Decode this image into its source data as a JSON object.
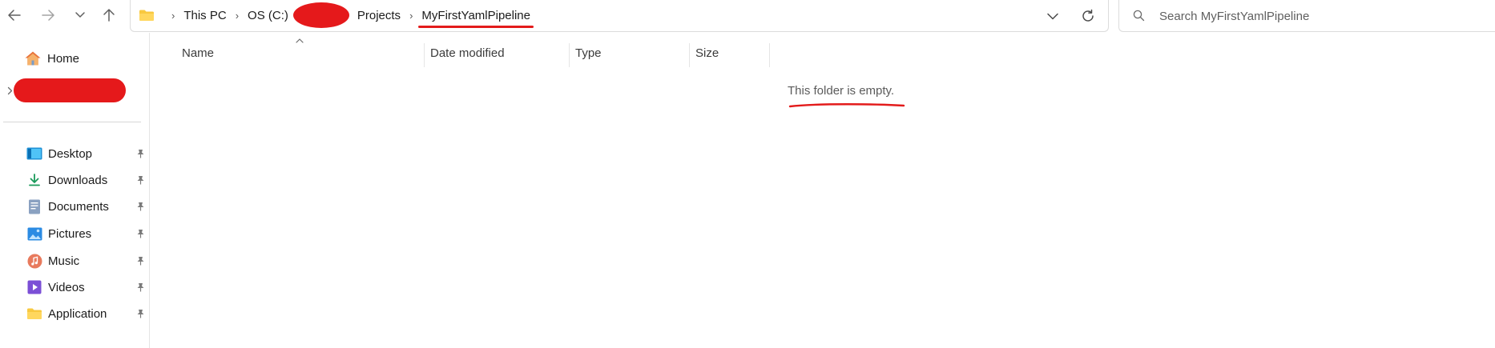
{
  "nav": {
    "back_icon": "arrow-left-icon",
    "forward_icon": "arrow-right-icon",
    "recent_icon": "chevron-down-icon",
    "up_icon": "arrow-up-icon"
  },
  "address": {
    "crumbs": [
      "This PC",
      "OS (C:)",
      "Projects",
      "MyFirstYamlPipeline"
    ],
    "current": "MyFirstYamlPipeline"
  },
  "search": {
    "placeholder": "Search MyFirstYamlPipeline"
  },
  "sidebar": {
    "home_label": "Home",
    "quick_access": [
      {
        "label": "Desktop",
        "icon": "desktop-icon"
      },
      {
        "label": "Downloads",
        "icon": "download-icon"
      },
      {
        "label": "Documents",
        "icon": "document-icon"
      },
      {
        "label": "Pictures",
        "icon": "pictures-icon"
      },
      {
        "label": "Music",
        "icon": "music-icon"
      },
      {
        "label": "Videos",
        "icon": "video-icon"
      },
      {
        "label": "Application",
        "icon": "folder-icon"
      }
    ]
  },
  "columns": [
    "Name",
    "Date modified",
    "Type",
    "Size"
  ],
  "empty_message": "This folder is empty.",
  "colors": {
    "accent": "#0067c0",
    "folder": "#f8c940",
    "annotation": "#e31b1b"
  }
}
